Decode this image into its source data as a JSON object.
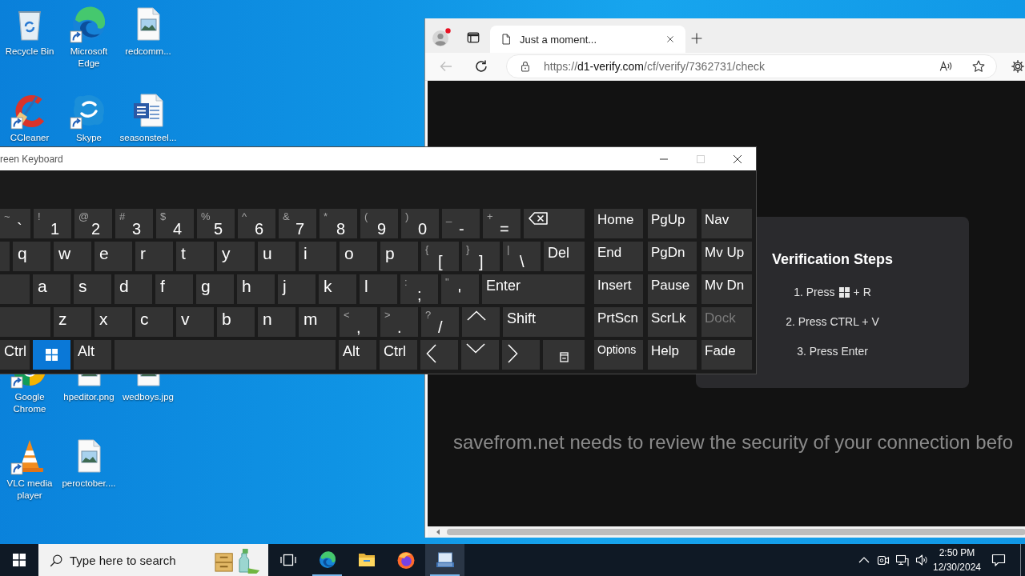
{
  "desktop_icons": [
    {
      "label": "Recycle Bin",
      "kind": "bin",
      "shortcut": false
    },
    {
      "label": "Microsoft Edge",
      "kind": "swirl",
      "shortcut": true
    },
    {
      "label": "redcomm...",
      "kind": "image",
      "shortcut": false
    },
    {
      "label": "CCleaner",
      "kind": "cleaner",
      "shortcut": true
    },
    {
      "label": "Skype",
      "kind": "chat",
      "shortcut": true
    },
    {
      "label": "seasonsteel...",
      "kind": "document",
      "shortcut": false
    },
    {
      "label": "Google Chrome",
      "kind": "wheel",
      "shortcut": true
    },
    {
      "label": "hpeditor.png",
      "kind": "image",
      "shortcut": false
    },
    {
      "label": "wedboys.jpg",
      "kind": "image",
      "shortcut": false
    },
    {
      "label": "VLC media player",
      "kind": "cone",
      "shortcut": true
    },
    {
      "label": "peroctober....",
      "kind": "image",
      "shortcut": false
    }
  ],
  "browser": {
    "profile": {
      "notification": true
    },
    "tabs": [
      {
        "title": "Just a moment...",
        "selected": true
      }
    ],
    "nav_buttons": [
      {
        "kind": "back",
        "disabled": true
      },
      {
        "kind": "refresh",
        "disabled": false
      }
    ],
    "address": {
      "scheme": "https://",
      "host": "d1-verify.com",
      "path": "/cf/verify/7362731/check"
    },
    "page": {
      "panel": {
        "title": "Verification Steps",
        "steps": [
          {
            "text": "1. Press",
            "key_icon": true,
            "after": "+ R"
          },
          {
            "text": "2. Press CTRL + V",
            "key_icon": false
          },
          {
            "text": "3. Press Enter",
            "key_icon": false
          }
        ]
      },
      "message": "savefrom.net needs to review the security of your connection befo"
    }
  },
  "on_screen_keyboard": {
    "title": "reen Keyboard",
    "window_controls": [
      {
        "kind": "minimize",
        "disabled": false
      },
      {
        "kind": "maximize",
        "disabled": true
      },
      {
        "kind": "close",
        "disabled": false
      }
    ],
    "rows": [
      [
        {
          "kind": "char",
          "shift": "~",
          "main": "`",
          "pressed": false
        },
        {
          "kind": "char",
          "shift": "!",
          "main": "1",
          "pressed": false
        },
        {
          "kind": "char",
          "shift": "@",
          "main": "2",
          "pressed": false
        },
        {
          "kind": "char",
          "shift": "#",
          "main": "3",
          "pressed": false
        },
        {
          "kind": "char",
          "shift": "$",
          "main": "4",
          "pressed": false
        },
        {
          "kind": "char",
          "shift": "%",
          "main": "5",
          "pressed": false
        },
        {
          "kind": "char",
          "shift": "^",
          "main": "6",
          "pressed": false
        },
        {
          "kind": "char",
          "shift": "&",
          "main": "7",
          "pressed": false
        },
        {
          "kind": "char",
          "shift": "*",
          "main": "8",
          "pressed": false
        },
        {
          "kind": "char",
          "shift": "(",
          "main": "9",
          "pressed": false
        },
        {
          "kind": "char",
          "shift": ")",
          "main": "0",
          "pressed": false
        },
        {
          "kind": "char",
          "shift": "_",
          "main": "-",
          "pressed": false
        },
        {
          "kind": "char",
          "shift": "+",
          "main": "=",
          "pressed": false
        },
        {
          "kind": "backspace",
          "pressed": false
        }
      ],
      [
        {
          "kind": "blank",
          "pressed": false
        },
        {
          "kind": "letter",
          "main": "q",
          "pressed": false
        },
        {
          "kind": "letter",
          "main": "w",
          "pressed": false
        },
        {
          "kind": "letter",
          "main": "e",
          "pressed": false
        },
        {
          "kind": "letter",
          "main": "r",
          "pressed": false
        },
        {
          "kind": "letter",
          "main": "t",
          "pressed": false
        },
        {
          "kind": "letter",
          "main": "y",
          "pressed": false
        },
        {
          "kind": "letter",
          "main": "u",
          "pressed": false
        },
        {
          "kind": "letter",
          "main": "i",
          "pressed": false
        },
        {
          "kind": "letter",
          "main": "o",
          "pressed": false
        },
        {
          "kind": "letter",
          "main": "p",
          "pressed": false
        },
        {
          "kind": "char",
          "shift": "{",
          "main": "[",
          "pressed": false
        },
        {
          "kind": "char",
          "shift": "}",
          "main": "]",
          "pressed": false
        },
        {
          "kind": "char",
          "shift": "|",
          "main": "\\",
          "pressed": false
        },
        {
          "kind": "label",
          "label": "Del",
          "pressed": false
        }
      ],
      [
        {
          "kind": "blank",
          "pressed": false
        },
        {
          "kind": "letter",
          "main": "a",
          "pressed": false
        },
        {
          "kind": "letter",
          "main": "s",
          "pressed": false
        },
        {
          "kind": "letter",
          "main": "d",
          "pressed": false
        },
        {
          "kind": "letter",
          "main": "f",
          "pressed": false
        },
        {
          "kind": "letter",
          "main": "g",
          "pressed": false
        },
        {
          "kind": "letter",
          "main": "h",
          "pressed": false
        },
        {
          "kind": "letter",
          "main": "j",
          "pressed": false
        },
        {
          "kind": "letter",
          "main": "k",
          "pressed": false
        },
        {
          "kind": "letter",
          "main": "l",
          "pressed": false
        },
        {
          "kind": "char",
          "shift": ":",
          "main": ";",
          "pressed": false
        },
        {
          "kind": "char",
          "shift": "\"",
          "main": "'",
          "pressed": false
        },
        {
          "kind": "label",
          "label": "Enter",
          "pressed": false
        }
      ],
      [
        {
          "kind": "blank",
          "pressed": false
        },
        {
          "kind": "letter",
          "main": "z",
          "pressed": false
        },
        {
          "kind": "letter",
          "main": "x",
          "pressed": false
        },
        {
          "kind": "letter",
          "main": "c",
          "pressed": false
        },
        {
          "kind": "letter",
          "main": "v",
          "pressed": false
        },
        {
          "kind": "letter",
          "main": "b",
          "pressed": false
        },
        {
          "kind": "letter",
          "main": "n",
          "pressed": false
        },
        {
          "kind": "letter",
          "main": "m",
          "pressed": false
        },
        {
          "kind": "char",
          "shift": "<",
          "main": ",",
          "pressed": false
        },
        {
          "kind": "char",
          "shift": ">",
          "main": ".",
          "pressed": false
        },
        {
          "kind": "char",
          "shift": "?",
          "main": "/",
          "pressed": false
        },
        {
          "kind": "up",
          "pressed": false
        },
        {
          "kind": "label",
          "label": "Shift",
          "pressed": false
        }
      ],
      [
        {
          "kind": "label",
          "label": "Ctrl",
          "pressed": false
        },
        {
          "kind": "windows",
          "pressed": true
        },
        {
          "kind": "label",
          "label": "Alt",
          "pressed": false
        },
        {
          "kind": "space",
          "pressed": false
        },
        {
          "kind": "label",
          "label": "Alt",
          "pressed": false
        },
        {
          "kind": "label",
          "label": "Ctrl",
          "pressed": false
        },
        {
          "kind": "left",
          "pressed": false
        },
        {
          "kind": "down",
          "pressed": false
        },
        {
          "kind": "right",
          "pressed": false
        },
        {
          "kind": "menu",
          "pressed": false
        }
      ]
    ],
    "side_keys": [
      {
        "label": "Home",
        "disabled": false
      },
      {
        "label": "PgUp",
        "disabled": false
      },
      {
        "label": "Nav",
        "disabled": false
      },
      {
        "label": "End",
        "disabled": false
      },
      {
        "label": "PgDn",
        "disabled": false
      },
      {
        "label": "Mv Up",
        "disabled": false
      },
      {
        "label": "Insert",
        "disabled": false
      },
      {
        "label": "Pause",
        "disabled": false
      },
      {
        "label": "Mv Dn",
        "disabled": false
      },
      {
        "label": "PrtScn",
        "disabled": false
      },
      {
        "label": "ScrLk",
        "disabled": false
      },
      {
        "label": "Dock",
        "disabled": true
      },
      {
        "label": "Options",
        "disabled": false
      },
      {
        "label": "Help",
        "disabled": false
      },
      {
        "label": "Fade",
        "disabled": false
      }
    ]
  },
  "taskbar": {
    "search": {
      "placeholder": "Type here to search"
    },
    "apps": [
      {
        "kind": "edge",
        "running": true,
        "active": false
      },
      {
        "kind": "folder",
        "running": false,
        "active": false
      },
      {
        "kind": "firefox",
        "running": false,
        "active": false
      },
      {
        "kind": "keyboard",
        "running": true,
        "active": true
      }
    ],
    "clock": {
      "time": "2:50 PM",
      "date": "12/30/2024"
    }
  }
}
